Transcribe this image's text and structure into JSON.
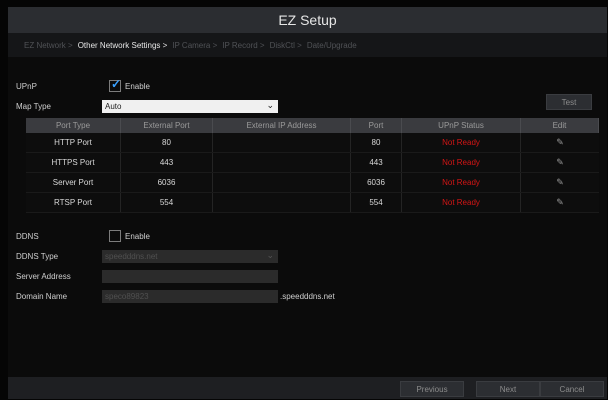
{
  "window": {
    "title": "EZ Setup"
  },
  "steps": [
    {
      "label": "EZ Network >",
      "active": false
    },
    {
      "label": "Other Network Settings >",
      "active": true
    },
    {
      "label": "IP Camera >",
      "active": false
    },
    {
      "label": "IP Record >",
      "active": false
    },
    {
      "label": "DiskCtl >",
      "active": false
    },
    {
      "label": "Date/Upgrade",
      "active": false
    }
  ],
  "upnp": {
    "label": "UPnP",
    "enable_label": "Enable",
    "checked": true
  },
  "map_type": {
    "label": "Map Type",
    "value": "Auto",
    "test_label": "Test"
  },
  "table": {
    "headers": [
      "Port Type",
      "External Port",
      "External IP Address",
      "Port",
      "UPnP Status",
      "Edit"
    ],
    "rows": [
      {
        "port_type": "HTTP Port",
        "external_port": "80",
        "external_ip": "",
        "port": "80",
        "status": "Not Ready"
      },
      {
        "port_type": "HTTPS Port",
        "external_port": "443",
        "external_ip": "",
        "port": "443",
        "status": "Not Ready"
      },
      {
        "port_type": "Server Port",
        "external_port": "6036",
        "external_ip": "",
        "port": "6036",
        "status": "Not Ready"
      },
      {
        "port_type": "RTSP Port",
        "external_port": "554",
        "external_ip": "",
        "port": "554",
        "status": "Not Ready"
      }
    ]
  },
  "ddns": {
    "label": "DDNS",
    "enable_label": "Enable",
    "checked": false,
    "type_label": "DDNS Type",
    "type_value": "speedddns.net",
    "server_label": "Server Address",
    "server_value": "",
    "domain_label": "Domain Name",
    "domain_value": "speco89823",
    "domain_suffix": ".speedddns.net"
  },
  "footer": {
    "previous_label": "Previous",
    "next_label": "Next",
    "cancel_label": "Cancel"
  }
}
